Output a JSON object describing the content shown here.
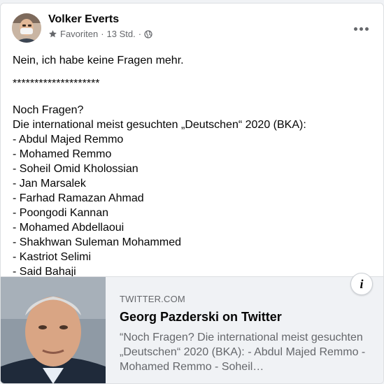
{
  "post": {
    "author": "Volker Everts",
    "audience": "Favoriten",
    "separator": "·",
    "timestamp": "13 Std.",
    "separator2": "·",
    "lines_top": [
      "Nein, ich habe keine Fragen mehr.",
      "********************"
    ],
    "intro": [
      "Noch Fragen?",
      "Die international meist gesuchten „Deutschen“ 2020 (BKA):"
    ],
    "names": [
      "- Abdul Majed Remmo",
      "- Mohamed Remmo",
      "- Soheil Omid Kholossian",
      "- Jan Marsalek",
      "- Farhad Ramazan Ahmad",
      "- Poongodi Kannan",
      "- Mohamed Abdellaoui",
      "- Shakhwan Suleman Mohammed",
      "- Kastriot Selimi",
      "- Said Bahaji"
    ]
  },
  "link_preview": {
    "domain": "TWITTER.COM",
    "title": "Georg Pazderski on Twitter",
    "description": "“Noch Fragen? Die international meist gesuchten „Deutschen“ 2020 (BKA): - Abdul Majed Remmo - Mohamed Remmo - Soheil…",
    "info_label": "i"
  },
  "icons": {
    "star": "star-icon",
    "globe": "globe-icon",
    "more": "more-options-icon",
    "info": "info-icon"
  },
  "colors": {
    "text": "#050505",
    "secondary": "#65676b",
    "card_bg": "#f0f2f5"
  }
}
